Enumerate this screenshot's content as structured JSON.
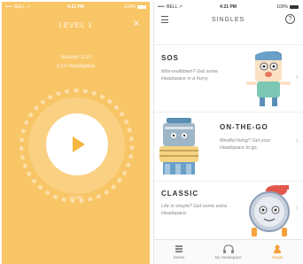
{
  "left_screen": {
    "status": {
      "carrier": "••••◦ BELL ↗",
      "time": "4:21 PM",
      "battery": "100%",
      "battery_level": 1.0
    },
    "title": "LEVEL 1",
    "subtitle_line1": "Session 1/10",
    "subtitle_line2": "1/10 Headspace",
    "timer": "10:00"
  },
  "right_screen": {
    "status": {
      "carrier": "••••◦ BELL ↗",
      "time": "4:21 PM",
      "battery": "100%",
      "battery_level": 1.0
    },
    "nav_title": "SINGLES",
    "help_label": "?",
    "cards": [
      {
        "title": "SOS",
        "desc": "Mini-meltdown? Get some Headspace in a hurry."
      },
      {
        "title": "ON-THE-GO",
        "desc": "Mindful living? Get your Headspace to go."
      },
      {
        "title": "CLASSIC",
        "desc": "Life is simple? Get some extra Headspace."
      }
    ],
    "tabs": [
      {
        "label": "Series",
        "icon": "series-icon"
      },
      {
        "label": "My Headspace",
        "icon": "headphones-icon"
      },
      {
        "label": "Single",
        "icon": "single-icon"
      }
    ],
    "accent_color": "#f6a13b"
  },
  "colors": {
    "player_bg": "#f9c667",
    "play_icon": "#f6b643"
  }
}
